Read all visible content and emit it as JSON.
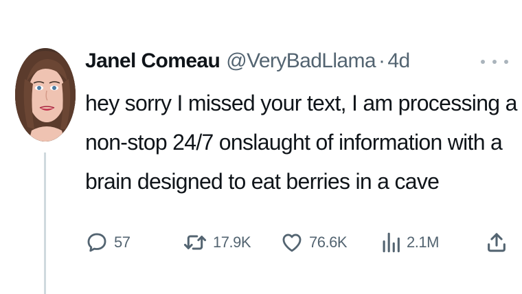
{
  "author": {
    "display_name": "Janel Comeau",
    "handle": "@VeryBadLlama",
    "separator": "·",
    "time": "4d",
    "avatar_icon": "profile-photo"
  },
  "tweet": {
    "lines": [
      "hey sorry I missed your text, I am processing a",
      "non-stop 24/7 onslaught of information with a",
      "brain designed to eat berries in a cave"
    ]
  },
  "actions": {
    "replies": "57",
    "retweets": "17.9K",
    "likes": "76.6K",
    "views": "2.1M"
  },
  "icons": {
    "reply": "reply-bubble-icon",
    "retweet": "retweet-icon",
    "like": "heart-icon",
    "views": "views-bar-chart-icon",
    "share": "share-upload-icon",
    "more": "more-horizontal-icon"
  },
  "colors": {
    "text": "#0f1419",
    "secondary": "#536471",
    "thread_line": "#cfd9de"
  }
}
